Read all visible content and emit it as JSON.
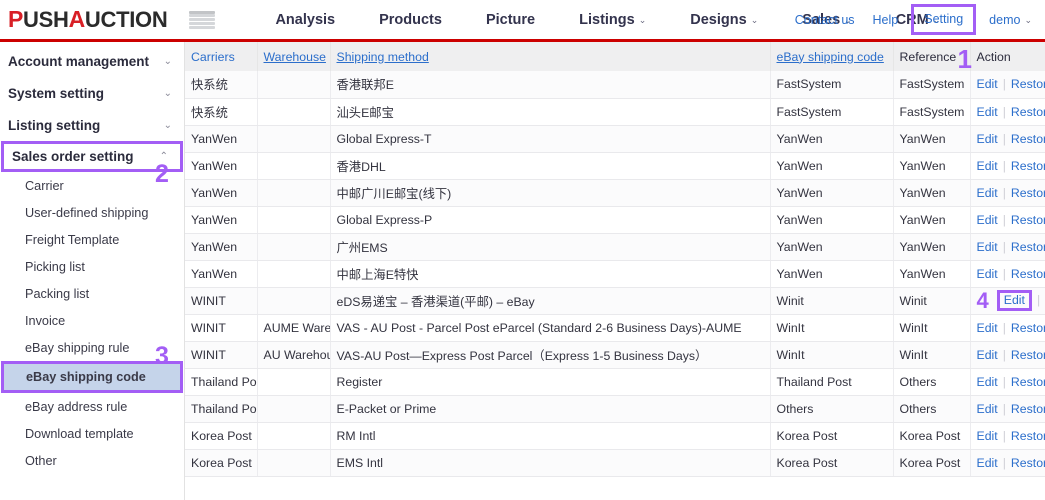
{
  "brand": {
    "prefix_p": "P",
    "word1": "USH",
    "prefix_a": "A",
    "word2": "UCTION"
  },
  "topnav": {
    "items": [
      {
        "label": "Analysis",
        "caret": false
      },
      {
        "label": "Products",
        "caret": false
      },
      {
        "label": "Picture",
        "caret": false
      },
      {
        "label": "Listings",
        "caret": true
      },
      {
        "label": "Designs",
        "caret": true
      },
      {
        "label": "Sales",
        "caret": true
      },
      {
        "label": "CRM",
        "caret": true
      }
    ],
    "right": [
      {
        "label": "Contact us",
        "caret": false,
        "boxed": false
      },
      {
        "label": "Help",
        "caret": false,
        "boxed": false
      },
      {
        "label": "Setting",
        "caret": false,
        "boxed": true
      },
      {
        "label": "demo",
        "caret": true,
        "boxed": false
      }
    ]
  },
  "annotations": {
    "n1": "1",
    "n2": "2",
    "n3": "3",
    "n4": "4"
  },
  "sidebar": {
    "groups": [
      {
        "label": "Account management",
        "chevron": "⌄",
        "boxed": false
      },
      {
        "label": "System setting",
        "chevron": "⌄",
        "boxed": false
      },
      {
        "label": "Listing setting",
        "chevron": "⌄",
        "boxed": false
      },
      {
        "label": "Sales order setting",
        "chevron": "⌃",
        "boxed": true
      }
    ],
    "items": [
      {
        "label": "Carrier",
        "selected": false
      },
      {
        "label": "User-defined shipping",
        "selected": false
      },
      {
        "label": "Freight Template",
        "selected": false
      },
      {
        "label": "Picking list",
        "selected": false
      },
      {
        "label": "Packing list",
        "selected": false
      },
      {
        "label": "Invoice",
        "selected": false
      },
      {
        "label": "eBay shipping rule",
        "selected": false
      },
      {
        "label": "eBay shipping code",
        "selected": true
      },
      {
        "label": "eBay address rule",
        "selected": false
      },
      {
        "label": "Download template",
        "selected": false
      },
      {
        "label": "Other",
        "selected": false
      }
    ]
  },
  "table": {
    "headers": [
      {
        "label": "Carriers",
        "link": true,
        "underline": false
      },
      {
        "label": "Warehouse",
        "link": true,
        "underline": true
      },
      {
        "label": "Shipping method",
        "link": true,
        "underline": true
      },
      {
        "label": "eBay shipping code",
        "link": true,
        "underline": true
      },
      {
        "label": "Reference",
        "link": false,
        "underline": false
      },
      {
        "label": "Action",
        "link": false,
        "underline": false
      }
    ],
    "action_edit": "Edit",
    "action_restore": "Restore reference value",
    "rows": [
      {
        "carrier": "快系统",
        "warehouse": "",
        "method": "香港联邦E",
        "code": "FastSystem",
        "reference": "FastSystem",
        "edit_boxed": false,
        "annot": ""
      },
      {
        "carrier": "快系统",
        "warehouse": "",
        "method": "汕头E邮宝",
        "code": "FastSystem",
        "reference": "FastSystem",
        "edit_boxed": false,
        "annot": ""
      },
      {
        "carrier": "YanWen",
        "warehouse": "",
        "method": "Global Express-T",
        "code": "YanWen",
        "reference": "YanWen",
        "edit_boxed": false,
        "annot": ""
      },
      {
        "carrier": "YanWen",
        "warehouse": "",
        "method": "香港DHL",
        "code": "YanWen",
        "reference": "YanWen",
        "edit_boxed": false,
        "annot": ""
      },
      {
        "carrier": "YanWen",
        "warehouse": "",
        "method": "中邮广川E邮宝(线下)",
        "code": "YanWen",
        "reference": "YanWen",
        "edit_boxed": false,
        "annot": ""
      },
      {
        "carrier": "YanWen",
        "warehouse": "",
        "method": "Global Express-P",
        "code": "YanWen",
        "reference": "YanWen",
        "edit_boxed": false,
        "annot": ""
      },
      {
        "carrier": "YanWen",
        "warehouse": "",
        "method": "广州EMS",
        "code": "YanWen",
        "reference": "YanWen",
        "edit_boxed": false,
        "annot": ""
      },
      {
        "carrier": "YanWen",
        "warehouse": "",
        "method": "中邮上海E特快",
        "code": "YanWen",
        "reference": "YanWen",
        "edit_boxed": false,
        "annot": ""
      },
      {
        "carrier": "WINIT",
        "warehouse": "",
        "method": "eDS易递宝 – 香港渠道(平邮) – eBay",
        "code": "Winit",
        "reference": "Winit",
        "edit_boxed": true,
        "annot": "4"
      },
      {
        "carrier": "WINIT",
        "warehouse": "AUME Warehouse",
        "method": "VAS - AU Post - Parcel Post eParcel (Standard 2-6 Business Days)-AUME",
        "code": "WinIt",
        "reference": "WinIt",
        "edit_boxed": false,
        "annot": ""
      },
      {
        "carrier": "WINIT",
        "warehouse": "AU Warehouse",
        "method": "VAS-AU Post—Express Post Parcel（Express 1-5 Business Days）",
        "code": "WinIt",
        "reference": "WinIt",
        "edit_boxed": false,
        "annot": ""
      },
      {
        "carrier": "Thailand Post",
        "warehouse": "",
        "method": "Register",
        "code": "Thailand Post",
        "reference": "Others",
        "edit_boxed": false,
        "annot": ""
      },
      {
        "carrier": "Thailand Post",
        "warehouse": "",
        "method": "E-Packet or Prime",
        "code": "Others",
        "reference": "Others",
        "edit_boxed": false,
        "annot": ""
      },
      {
        "carrier": "Korea Post",
        "warehouse": "",
        "method": "RM Intl",
        "code": "Korea Post",
        "reference": "Korea Post",
        "edit_boxed": false,
        "annot": ""
      },
      {
        "carrier": "Korea Post",
        "warehouse": "",
        "method": "EMS Intl",
        "code": "Korea Post",
        "reference": "Korea Post",
        "edit_boxed": false,
        "annot": ""
      }
    ]
  },
  "colors": {
    "brand_red": "#d81f26",
    "link_blue": "#2b6ecb",
    "annotation_purple": "#a35ef5",
    "selected_bg": "#c5d4ea"
  }
}
